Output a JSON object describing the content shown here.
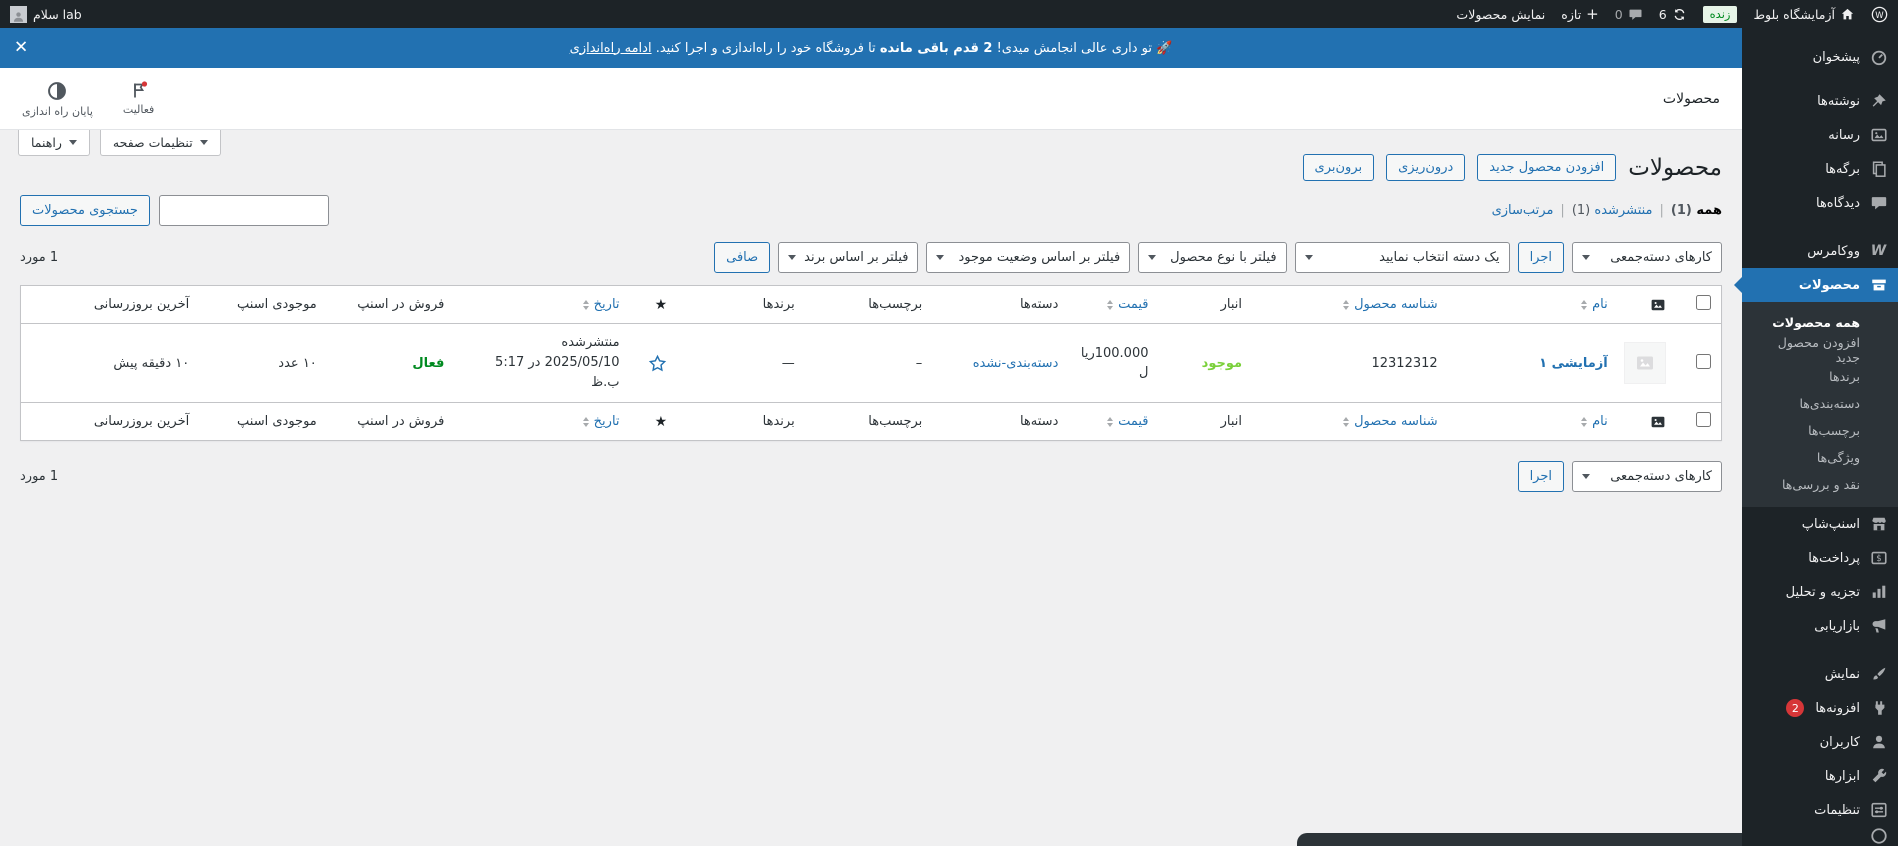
{
  "admin_bar": {
    "site_name": "آزمایشگاه بلوط",
    "live_badge": "زنده",
    "updates_count": "6",
    "comments_count": "0",
    "new_label": "تازه",
    "view_products_label": "نمایش محصولات",
    "greeting": "سلام lab"
  },
  "banner": {
    "emoji": "🚀",
    "text_pre": "تو داری عالی انجامش میدی!",
    "text_bold": "2 قدم باقی مانده",
    "text_post": "تا فروشگاه خود را راه‌اندازی و اجرا کنید.",
    "link_label": "ادامه راه‌اندازی",
    "close_glyph": "✕"
  },
  "header": {
    "page_label": "محصولات",
    "activity_label": "فعالیت",
    "finish_setup_label": "پایان راه اندازی",
    "screen_options_label": "تنظیمات صفحه",
    "help_label": "راهنما"
  },
  "page": {
    "title": "محصولات",
    "add_new_label": "افزودن محصول جدید",
    "import_label": "درون‌ریزی",
    "export_label": "برون‌بری",
    "views": [
      {
        "label": "همه",
        "count": "(1)"
      },
      {
        "label": "منتشرشده",
        "count": "(1)"
      },
      {
        "label": "مرتب‌سازی",
        "count": ""
      }
    ],
    "view_separator": "|",
    "search_button_label": "جستجوی محصولات",
    "items_count": "1 مورد"
  },
  "toolbar": {
    "bulk_actions_label": "کارهای دسته‌جمعی",
    "apply_label": "اجرا",
    "category_filter_label": "یک دسته انتخاب نمایید",
    "type_filter_label": "فیلتر با نوع محصول",
    "stock_filter_label": "فیلتر بر اساس وضعیت موجود",
    "brand_filter_label": "فیلتر بر اساس برند",
    "filter_button_label": "صافی"
  },
  "table": {
    "headers": {
      "name": "نام",
      "product_id": "شناسه محصول",
      "stock": "انبار",
      "price": "قیمت",
      "categories": "دسته‌ها",
      "tags": "برچسب‌ها",
      "brands": "برندها",
      "star": "★",
      "date": "تاریخ",
      "snapp_sale": "فروش در اسنپ",
      "snapp_stock": "موجودی اسنپ",
      "last_update": "آخرین بروزرسانی"
    },
    "row": {
      "name": "آزمایشی ۱",
      "product_id": "12312312",
      "stock_status": "موجود",
      "price": "100.000ریال",
      "category": "دسته‌بندی-نشده",
      "tags": "–",
      "brands": "—",
      "date_status": "منتشرشده",
      "date_value": "2025/05/10 در 5:17 ب.ظ",
      "snapp_sale": "فعال",
      "snapp_stock": "۱۰ عدد",
      "last_update": "۱۰ دقیقه پیش"
    }
  },
  "sidebar": {
    "items": [
      {
        "label": "پیشخوان"
      },
      {
        "label": "نوشته‌ها"
      },
      {
        "label": "رسانه"
      },
      {
        "label": "برگه‌ها"
      },
      {
        "label": "دیدگاه‌ها"
      },
      {
        "label": "ووکامرس"
      },
      {
        "label": "محصولات"
      },
      {
        "label": "اسنپ‌شاپ"
      },
      {
        "label": "پرداخت‌ها"
      },
      {
        "label": "تجزیه و تحلیل"
      },
      {
        "label": "بازاریابی"
      },
      {
        "label": "نمایش"
      },
      {
        "label": "افزونه‌ها",
        "badge": "2"
      },
      {
        "label": "کاربران"
      },
      {
        "label": "ابزارها"
      },
      {
        "label": "تنظیمات"
      }
    ],
    "submenu": [
      {
        "label": "همه محصولات"
      },
      {
        "label": "افزودن محصول جدید"
      },
      {
        "label": "برندها"
      },
      {
        "label": "دسته‌بندی‌ها"
      },
      {
        "label": "برچسب‌ها"
      },
      {
        "label": "ویژگی‌ها"
      },
      {
        "label": "نقد و بررسی‌ها"
      }
    ]
  },
  "colors": {
    "accent_blue": "#2271b1",
    "dark_bar": "#1d2327",
    "submenu_bg": "#2c3338",
    "in_stock_green": "#7ad03a",
    "active_green": "#008a20",
    "badge_red": "#d63638"
  }
}
